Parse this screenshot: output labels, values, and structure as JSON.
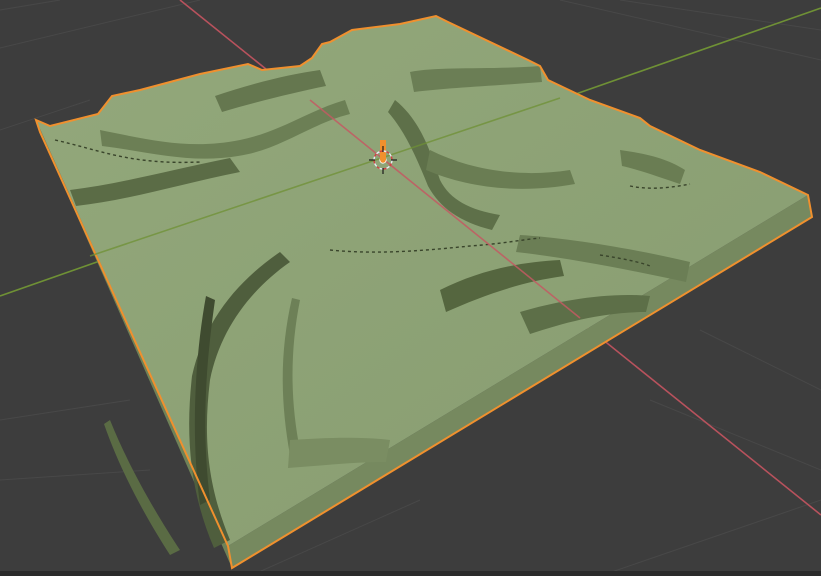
{
  "viewport": {
    "mode": "3d-viewport",
    "background_color": "#3d3d3d",
    "grid_line_color": "#4a4a4a",
    "x_axis_color": "#c45a63",
    "y_axis_color": "#7a9a3a",
    "selection_outline_color": "#f0902e",
    "mesh_color": "#8ea377",
    "mesh_side_color": "#76895f",
    "mesh_shadow_color": "#4f5e3d",
    "cursor_color": "#e8eef6",
    "origin_color": "#f0902e"
  },
  "scene": {
    "selected_object": "terrain-mesh",
    "icons": {
      "cursor": "3d-cursor-icon",
      "origin": "object-origin-icon"
    }
  }
}
